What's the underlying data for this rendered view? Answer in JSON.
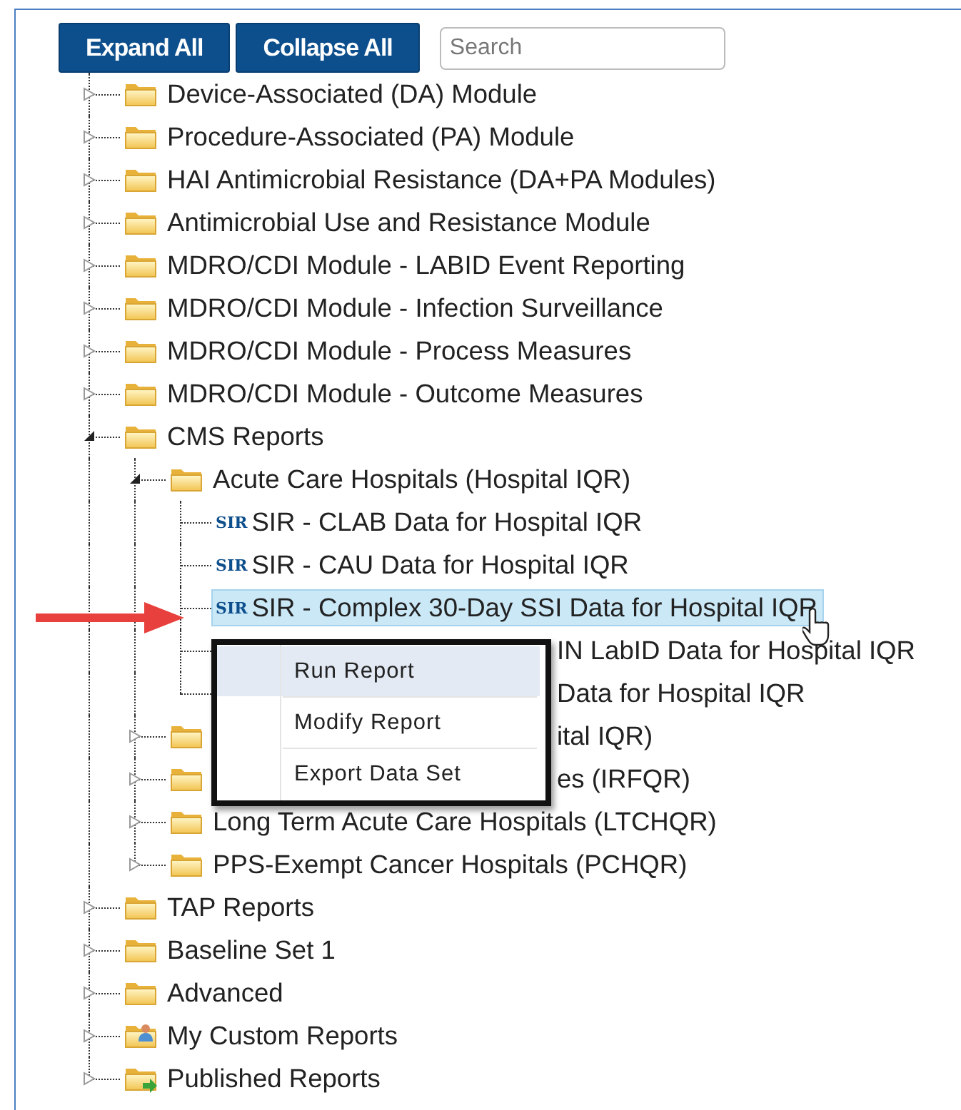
{
  "toolbar": {
    "buttons": [
      "Expand All",
      "Collapse All"
    ],
    "search": {
      "placeholder": "Search"
    }
  },
  "tree": [
    {
      "kind": "folder",
      "label": "Device-Associated (DA) Module",
      "expanded": false
    },
    {
      "kind": "folder",
      "label": "Procedure-Associated (PA) Module",
      "expanded": false
    },
    {
      "kind": "folder",
      "label": "HAI Antimicrobial Resistance (DA+PA Modules)",
      "expanded": false
    },
    {
      "kind": "folder",
      "label": "Antimicrobial Use and Resistance Module",
      "expanded": false
    },
    {
      "kind": "folder",
      "label": "MDRO/CDI Module - LABID Event Reporting",
      "expanded": false
    },
    {
      "kind": "folder",
      "label": "MDRO/CDI Module - Infection Surveillance",
      "expanded": false
    },
    {
      "kind": "folder",
      "label": "MDRO/CDI Module - Process Measures",
      "expanded": false
    },
    {
      "kind": "folder",
      "label": "MDRO/CDI Module - Outcome Measures",
      "expanded": false
    },
    {
      "kind": "folder",
      "label": "CMS Reports",
      "expanded": true,
      "children": [
        {
          "kind": "folder",
          "label": "Acute Care Hospitals (Hospital IQR)",
          "expanded": true,
          "children": [
            {
              "kind": "report",
              "badge": "SIR",
              "label": "SIR - CLAB Data for Hospital IQR",
              "selected": false
            },
            {
              "kind": "report",
              "badge": "SIR",
              "label": "SIR - CAU Data for Hospital IQR",
              "selected": false
            },
            {
              "kind": "report",
              "badge": "SIR",
              "label": "SIR - Complex 30-Day SSI Data for Hospital IQR",
              "selected": true
            },
            {
              "kind": "report",
              "label": "IN LabID Data for Hospital IQR",
              "selected": false,
              "covered": true
            },
            {
              "kind": "report",
              "label": "Data for Hospital IQR",
              "selected": false,
              "covered": true
            }
          ]
        },
        {
          "kind": "folder",
          "label": "ital IQR)",
          "expanded": false,
          "covered": true
        },
        {
          "kind": "folder",
          "label": "es (IRFQR)",
          "expanded": false,
          "covered": true
        },
        {
          "kind": "folder",
          "label": "Long Term Acute Care Hospitals (LTCHQR)",
          "expanded": false
        },
        {
          "kind": "folder",
          "label": "PPS-Exempt Cancer Hospitals (PCHQR)",
          "expanded": false
        }
      ]
    },
    {
      "kind": "folder",
      "label": "TAP Reports",
      "expanded": false
    },
    {
      "kind": "folder",
      "label": "Baseline Set 1",
      "expanded": false
    },
    {
      "kind": "folder",
      "label": "Advanced",
      "expanded": false
    },
    {
      "kind": "custom-folder",
      "label": "My Custom Reports",
      "expanded": false
    },
    {
      "kind": "published-folder",
      "label": "Published Reports",
      "expanded": false
    }
  ],
  "context_menu": {
    "items": [
      {
        "label": "Run Report",
        "selected": true
      },
      {
        "label": "Modify Report",
        "selected": false
      },
      {
        "label": "Export Data Set",
        "selected": false
      }
    ]
  }
}
